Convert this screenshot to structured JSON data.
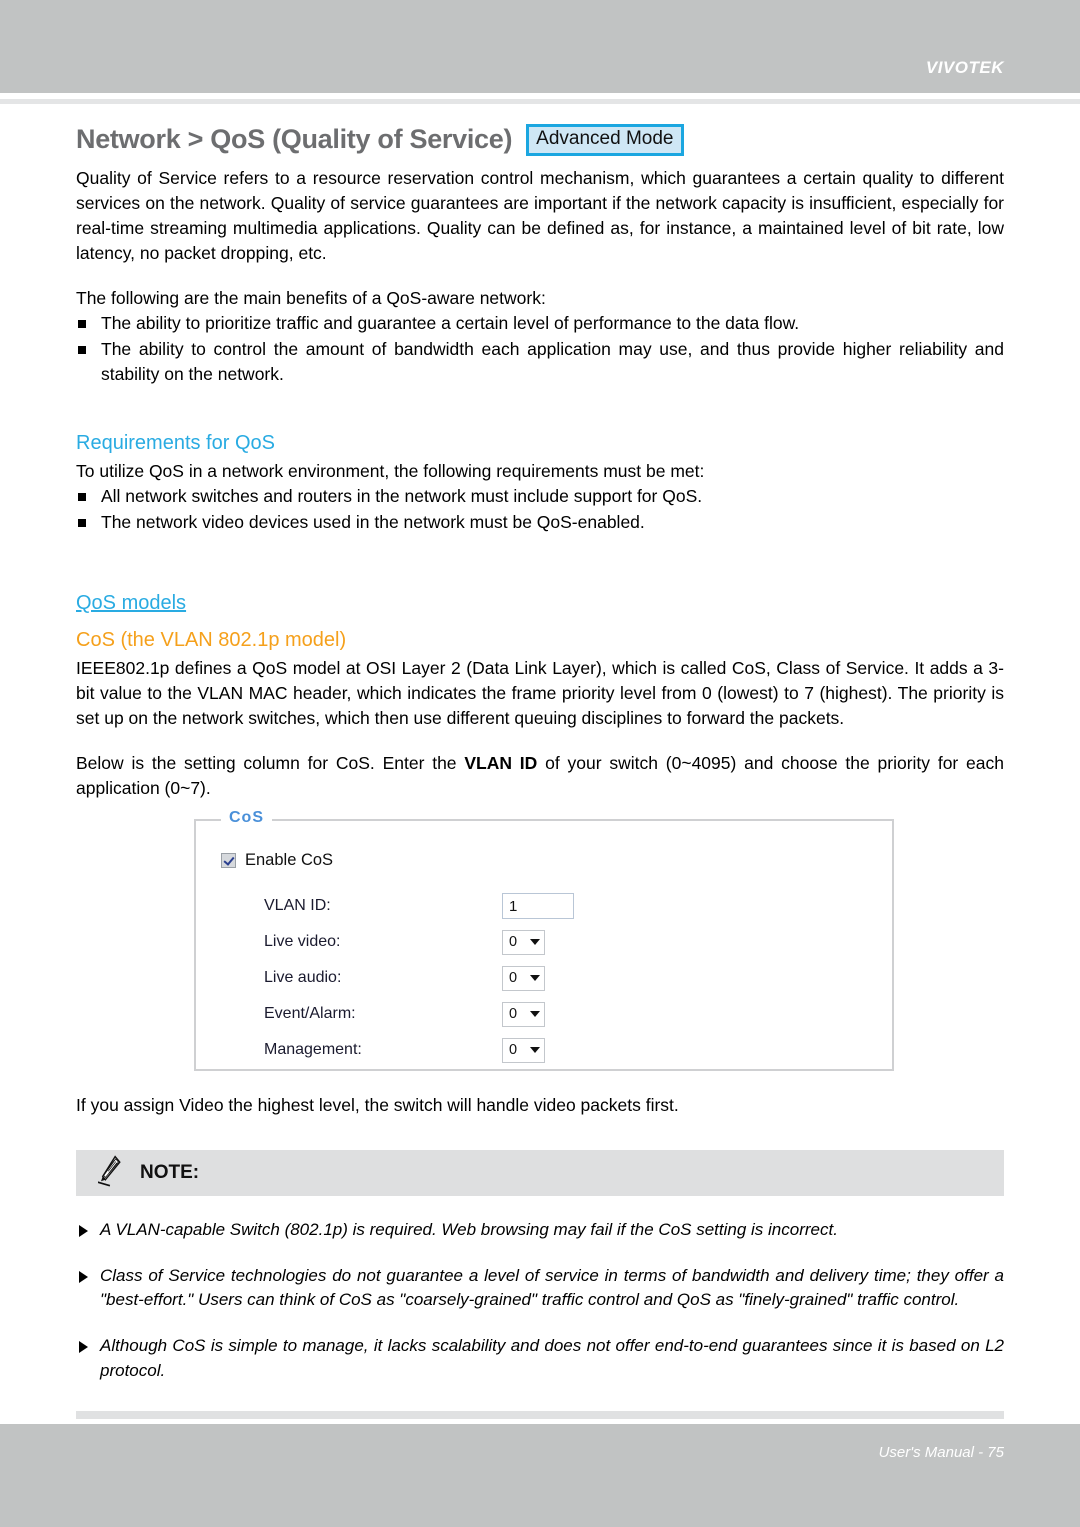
{
  "header": {
    "brand": "VIVOTEK"
  },
  "page": {
    "title": "Network > QoS (Quality of Service)",
    "mode_badge": "Advanced Mode",
    "intro": "Quality of Service refers to a resource reservation control mechanism, which guarantees a certain quality to different services on the network. Quality of service guarantees are important if the network capacity is insufficient, especially for real-time streaming multimedia applications. Quality can be defined as, for instance, a maintained level of bit rate, low latency, no packet dropping, etc.",
    "benefits_lead": "The following are the main benefits of a QoS-aware network:",
    "benefits": [
      "The ability to prioritize traffic and guarantee a certain level of performance to the data flow.",
      "The ability to control the amount of bandwidth each application may use, and thus provide higher reliability and stability on the network."
    ],
    "requirements_heading": "Requirements for QoS",
    "requirements_lead": "To utilize QoS in a network environment, the following requirements must be met:",
    "requirements": [
      "All network switches and routers in the network must include support for QoS.",
      "The network video devices used in the network must be QoS-enabled."
    ],
    "models_heading": "QoS models",
    "cos_heading": "CoS (the VLAN 802.1p model)",
    "cos_para": "IEEE802.1p defines a QoS model at OSI Layer 2 (Data Link Layer), which is called CoS, Class of Service. It adds a 3-bit value to the VLAN MAC header, which indicates the frame priority level from 0 (lowest) to 7 (highest). The priority is set up on the network switches, which then use different queuing disciplines to forward the packets.",
    "setting_para_before": "Below is the setting column for CoS. Enter the ",
    "setting_para_strong": "VLAN ID",
    "setting_para_after": " of your switch (0~4095) and choose the priority for each application (0~7).",
    "after_panel_para": "If you assign Video the highest level, the switch will handle video packets first."
  },
  "cos_panel": {
    "legend": "CoS",
    "enable_label": "Enable CoS",
    "enable_checked": true,
    "fields": [
      {
        "label": "VLAN ID:",
        "value": "1",
        "control": "text"
      },
      {
        "label": "Live video:",
        "value": "0",
        "control": "select"
      },
      {
        "label": "Live audio:",
        "value": "0",
        "control": "select"
      },
      {
        "label": "Event/Alarm:",
        "value": "0",
        "control": "select"
      },
      {
        "label": "Management:",
        "value": "0",
        "control": "select"
      }
    ]
  },
  "note": {
    "icon": "pencil-icon",
    "title": "NOTE:",
    "items": [
      "A VLAN-capable Switch (802.1p) is required. Web browsing may fail if the CoS setting is incorrect.",
      "Class of Service technologies do not guarantee a level of service in terms of bandwidth and delivery time; they offer a \"best-effort.\" Users can think of CoS as \"coarsely-grained\" traffic control and QoS as \"finely-grained\" traffic control.",
      "Although CoS is simple to manage, it lacks scalability and does not offer end-to-end guarantees since it is based on L2 protocol."
    ]
  },
  "footer": {
    "text": "User's Manual - 75"
  },
  "colors": {
    "band_gray": "#c1c3c3",
    "accent_blue": "#29abe2",
    "accent_orange": "#f5a01b",
    "badge_border": "#1ba6e0",
    "badge_fill": "#cfe7f5",
    "note_bar": "#dedfe0"
  }
}
